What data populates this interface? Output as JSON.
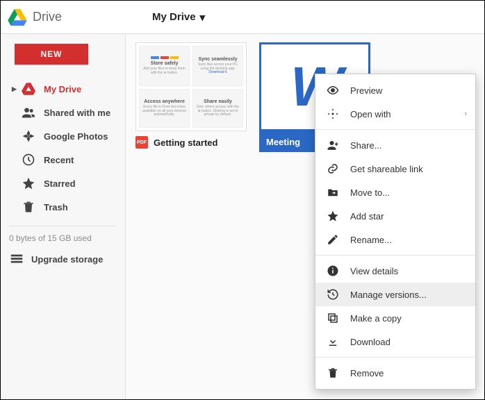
{
  "header": {
    "app_title": "Drive",
    "breadcrumb": "My Drive"
  },
  "sidebar": {
    "new_label": "NEW",
    "items": [
      {
        "label": "My Drive",
        "active": true
      },
      {
        "label": "Shared with me",
        "active": false
      },
      {
        "label": "Google Photos",
        "active": false
      },
      {
        "label": "Recent",
        "active": false
      },
      {
        "label": "Starred",
        "active": false
      },
      {
        "label": "Trash",
        "active": false
      }
    ],
    "storage_text": "0 bytes of 15 GB used",
    "upgrade_label": "Upgrade storage"
  },
  "files": [
    {
      "name": "Getting started",
      "type": "pdf",
      "quad_titles": [
        "Store safely",
        "Sync seamlessly",
        "Access anywhere",
        "Share easily"
      ]
    },
    {
      "name": "Meeting",
      "type": "doc",
      "selected": true
    }
  ],
  "context_menu": {
    "groups": [
      [
        {
          "icon": "eye",
          "label": "Preview"
        },
        {
          "icon": "open-with",
          "label": "Open with",
          "submenu": true
        }
      ],
      [
        {
          "icon": "person-plus",
          "label": "Share..."
        },
        {
          "icon": "link",
          "label": "Get shareable link"
        },
        {
          "icon": "folder-move",
          "label": "Move to..."
        },
        {
          "icon": "star",
          "label": "Add star"
        },
        {
          "icon": "pencil",
          "label": "Rename..."
        }
      ],
      [
        {
          "icon": "info",
          "label": "View details"
        },
        {
          "icon": "history",
          "label": "Manage versions...",
          "highlight": true
        },
        {
          "icon": "copy",
          "label": "Make a copy"
        },
        {
          "icon": "download",
          "label": "Download"
        }
      ],
      [
        {
          "icon": "trash",
          "label": "Remove"
        }
      ]
    ]
  }
}
